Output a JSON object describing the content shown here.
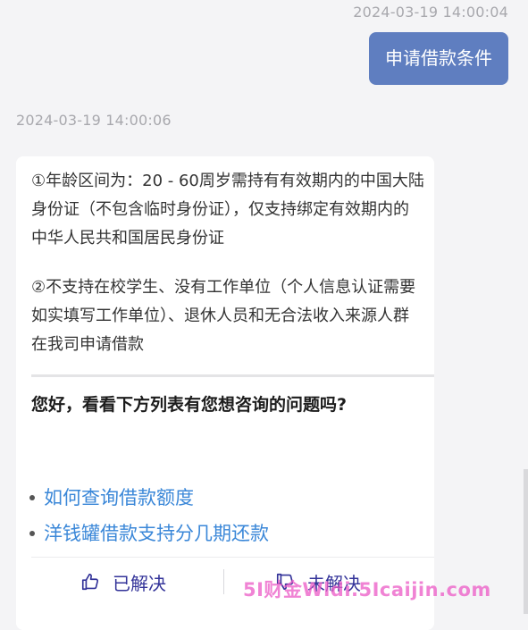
{
  "user_message": {
    "timestamp": "2024-03-19 14:00:04",
    "text": "申请借款条件"
  },
  "bot_message": {
    "timestamp": "2024-03-19 14:00:06",
    "paragraph_1": "①年龄区间为：20 - 60周岁需持有有效期内的中国大陆身份证（不包含临时身份证），仅支持绑定有效期内的中华人民共和国居民身份证",
    "paragraph_2": "②不支持在校学生、没有工作单位（个人信息认证需要如实填写工作单位）、退休人员和无合法收入来源人群在我司申请借款",
    "question": "您好，看看下方列表有您想咨询的问题吗?",
    "faq": [
      "如何查询借款额度",
      "洋钱罐借款支持分几期还款"
    ],
    "feedback": {
      "solved_label": "已解决",
      "unsolved_label": "未解决"
    }
  },
  "watermark": "5I财金Wldi.5Icaijin.com",
  "colors": {
    "user_bubble": "#5f7ec0",
    "link": "#3a87d8",
    "feedback": "#333399",
    "watermark": "#ec5ac6"
  },
  "icons": {
    "solved": "thumbs-up-icon",
    "unsolved": "thumbs-down-icon"
  }
}
